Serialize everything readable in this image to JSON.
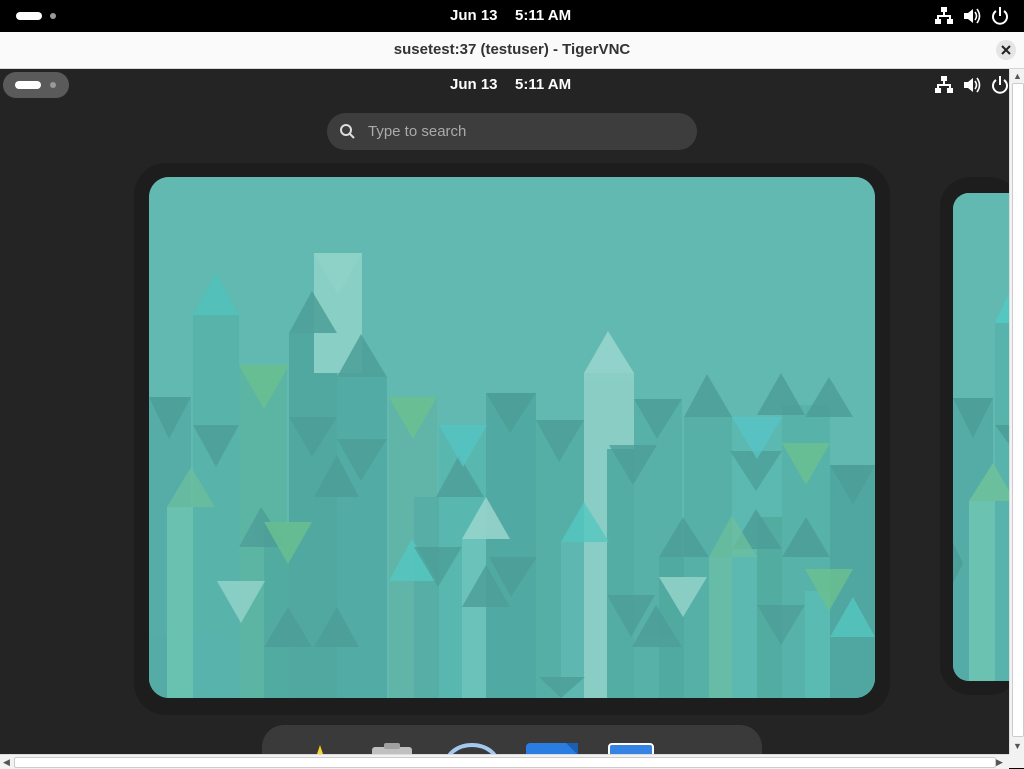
{
  "host": {
    "date": "Jun 13",
    "time": "5:11 AM",
    "tray_icons": [
      "network-icon",
      "volume-icon",
      "power-icon"
    ]
  },
  "window": {
    "title": "susetest:37 (testuser) - TigerVNC"
  },
  "remote": {
    "date": "Jun 13",
    "time": "5:11 AM",
    "search": {
      "placeholder": "Type to search"
    },
    "dash_apps": [
      "favorites-icon",
      "files-icon",
      "web-browser-icon",
      "software-icon",
      "terminal-icon"
    ]
  },
  "colors": {
    "shell_bg": "#242424",
    "wallpaper": "#62b9b2",
    "accent_light": "#9dd8d0"
  }
}
